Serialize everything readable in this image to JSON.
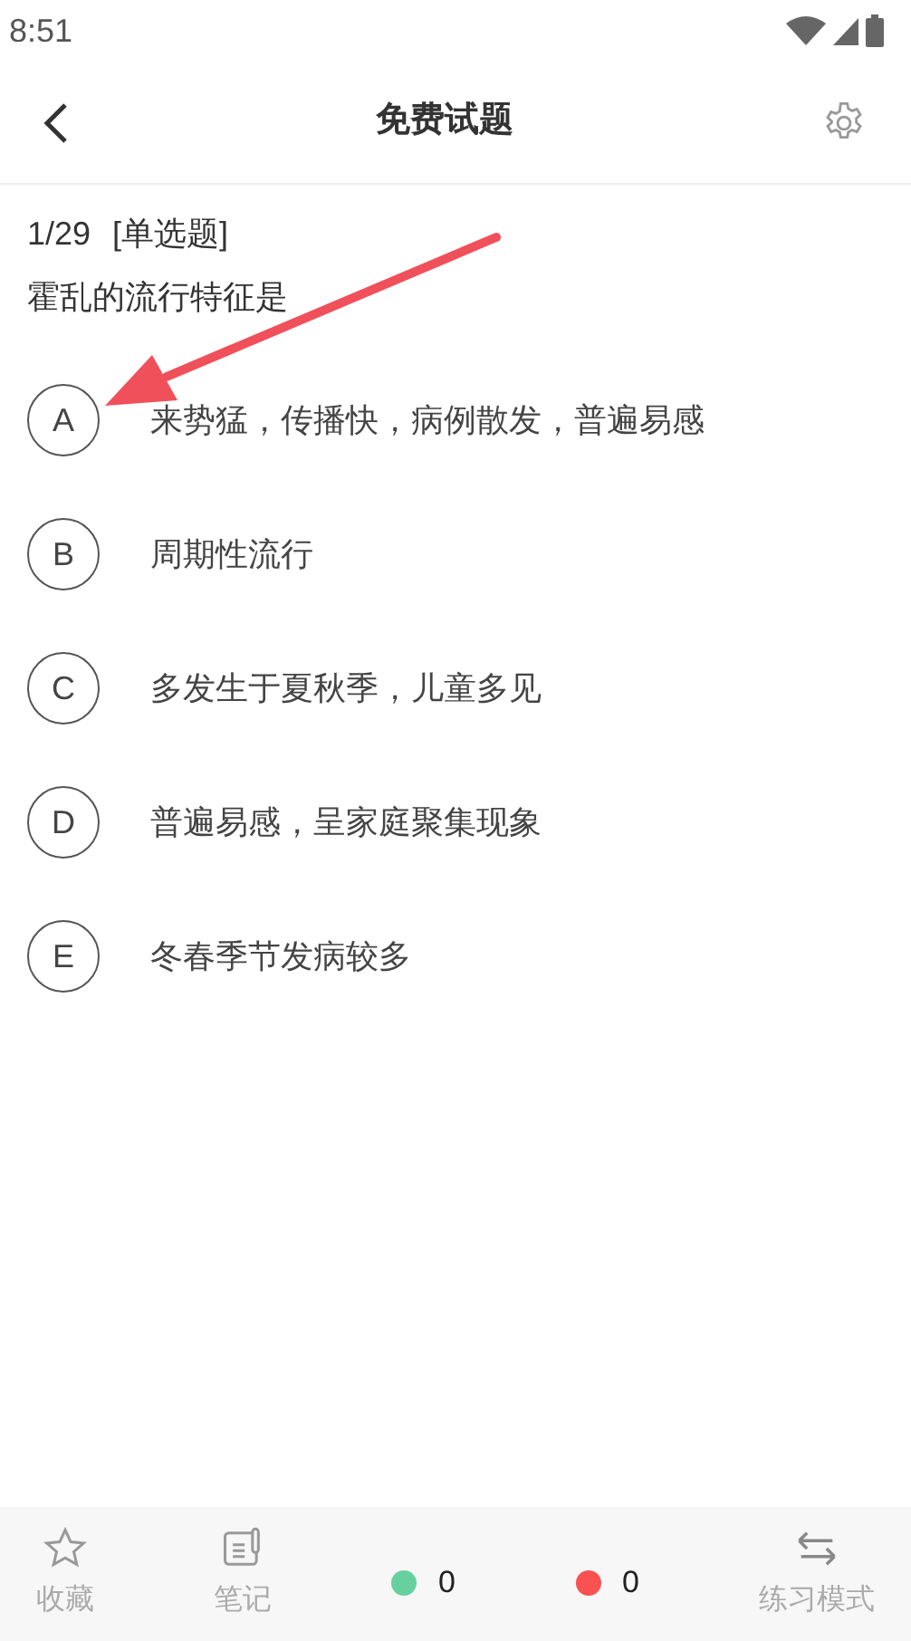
{
  "status_bar": {
    "time": "8:51"
  },
  "header": {
    "title": "免费试题"
  },
  "question": {
    "progress": "1/29",
    "type": "[单选题]",
    "stem": "霍乱的流行特征是",
    "options": [
      {
        "letter": "A",
        "text": "来势猛，传播快，病例散发，普遍易感"
      },
      {
        "letter": "B",
        "text": "周期性流行"
      },
      {
        "letter": "C",
        "text": "多发生于夏秋季，儿童多见"
      },
      {
        "letter": "D",
        "text": "普遍易感，呈家庭聚集现象"
      },
      {
        "letter": "E",
        "text": "冬春季节发病较多"
      }
    ]
  },
  "bottom_bar": {
    "items": [
      {
        "kind": "icon",
        "label": "收藏"
      },
      {
        "kind": "icon",
        "label": "笔记"
      },
      {
        "kind": "count",
        "color": "#66d19e",
        "count": "0"
      },
      {
        "kind": "count",
        "color": "#fa5151",
        "count": "0"
      },
      {
        "kind": "icon",
        "label": "练习模式"
      }
    ]
  }
}
